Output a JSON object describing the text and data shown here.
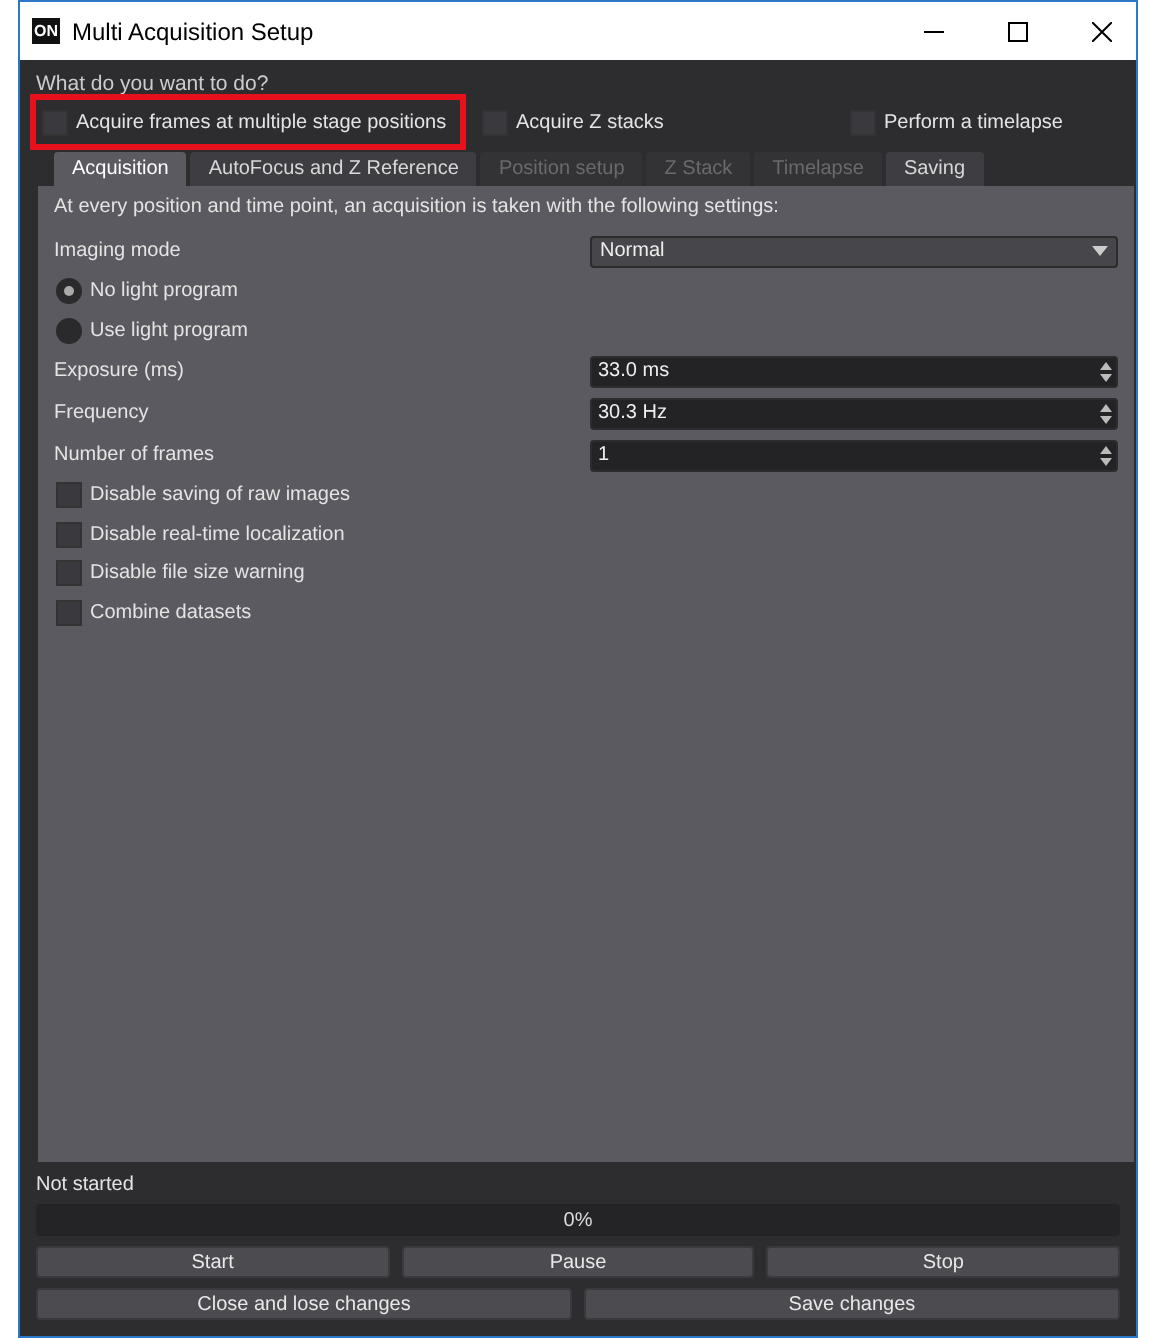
{
  "window": {
    "title": "Multi Acquisition Setup",
    "logo": "ON"
  },
  "prompt": "What do you want to do?",
  "goals": [
    {
      "label": "Acquire frames at multiple stage positions",
      "checked": false,
      "highlighted": true
    },
    {
      "label": "Acquire Z stacks",
      "checked": false,
      "highlighted": false
    },
    {
      "label": "Perform a timelapse",
      "checked": false,
      "highlighted": false
    }
  ],
  "tabs": [
    {
      "label": "Acquisition",
      "selected": true,
      "disabled": false
    },
    {
      "label": "AutoFocus and Z Reference",
      "selected": false,
      "disabled": false
    },
    {
      "label": "Position setup",
      "selected": false,
      "disabled": true
    },
    {
      "label": "Z Stack",
      "selected": false,
      "disabled": true
    },
    {
      "label": "Timelapse",
      "selected": false,
      "disabled": true
    },
    {
      "label": "Saving",
      "selected": false,
      "disabled": false
    }
  ],
  "intro": "At every position and time point, an acquisition is taken with the following settings:",
  "imaging_mode": {
    "label": "Imaging mode",
    "value": "Normal"
  },
  "light_program": [
    {
      "label": "No light program",
      "selected": true
    },
    {
      "label": "Use light program",
      "selected": false
    }
  ],
  "fields": [
    {
      "label": "Exposure (ms)",
      "value": "33.0 ms"
    },
    {
      "label": "Frequency",
      "value": "30.3 Hz"
    },
    {
      "label": "Number of frames",
      "value": "1"
    }
  ],
  "options": [
    {
      "label": "Disable saving of raw images",
      "checked": false
    },
    {
      "label": "Disable real-time localization",
      "checked": false
    },
    {
      "label": "Disable file size warning",
      "checked": false
    },
    {
      "label": "Combine datasets",
      "checked": false
    }
  ],
  "status": "Not started",
  "progress": {
    "level": 0,
    "text": "0%"
  },
  "run_buttons": [
    "Start",
    "Pause",
    "Stop"
  ],
  "close_buttons": [
    "Close and lose changes",
    "Save changes"
  ]
}
